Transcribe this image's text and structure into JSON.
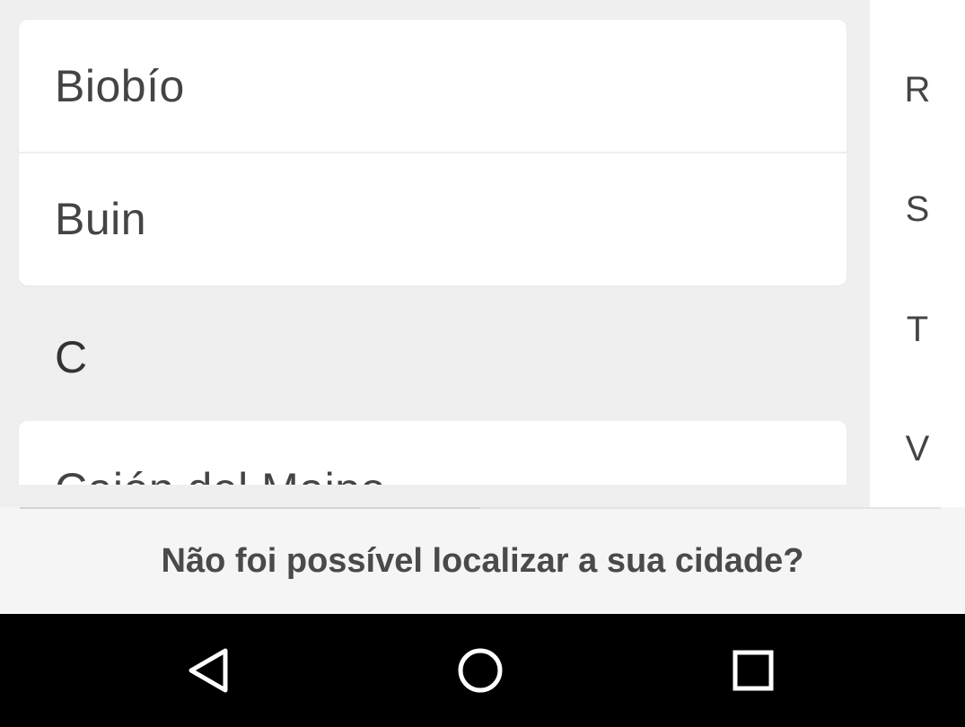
{
  "city_list": {
    "items": [
      {
        "label": "Biobío"
      },
      {
        "label": "Buin"
      }
    ],
    "section_header": "C",
    "partial_item": {
      "label": "Cajón del Maipo"
    }
  },
  "alphabet_index": {
    "letters": [
      "R",
      "S",
      "T",
      "V"
    ]
  },
  "footer": {
    "link_text": "Não foi possível localizar a sua cidade?"
  },
  "system_nav": {
    "back_icon": "back-triangle-icon",
    "home_icon": "home-circle-icon",
    "recents_icon": "recents-square-icon"
  },
  "colors": {
    "background": "#efefef",
    "card": "#ffffff",
    "text": "#444444",
    "nav_bar": "#000000"
  }
}
